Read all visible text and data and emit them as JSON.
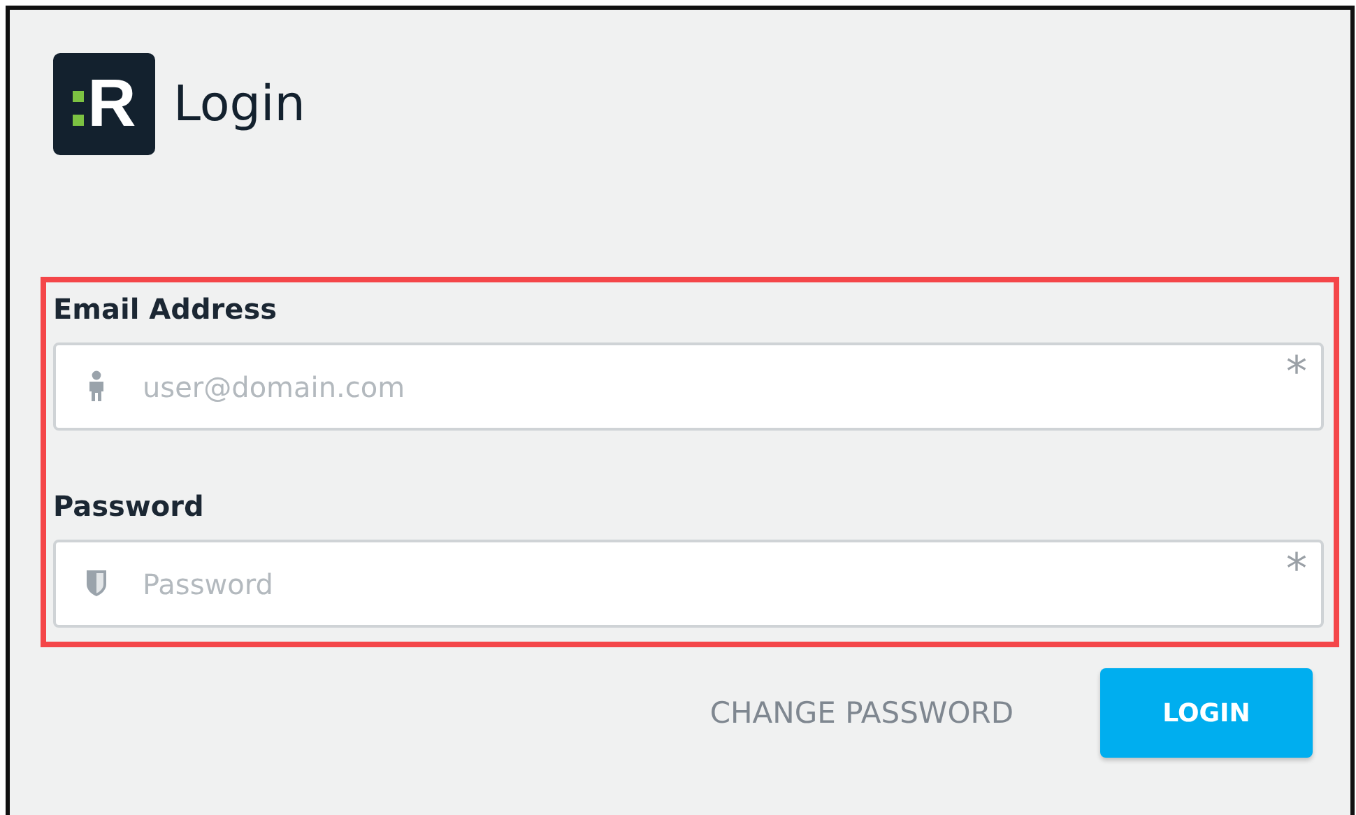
{
  "header": {
    "logo_letter": "R",
    "title": "Login"
  },
  "fields": [
    {
      "label": "Email Address",
      "placeholder": "user@domain.com",
      "kind": "email",
      "required": true,
      "required_mark": "*"
    },
    {
      "label": "Password",
      "placeholder": "Password",
      "kind": "password",
      "required": true,
      "required_mark": "*"
    }
  ],
  "actions": {
    "secondary": "CHANGE PASSWORD",
    "primary": "LOGIN"
  }
}
